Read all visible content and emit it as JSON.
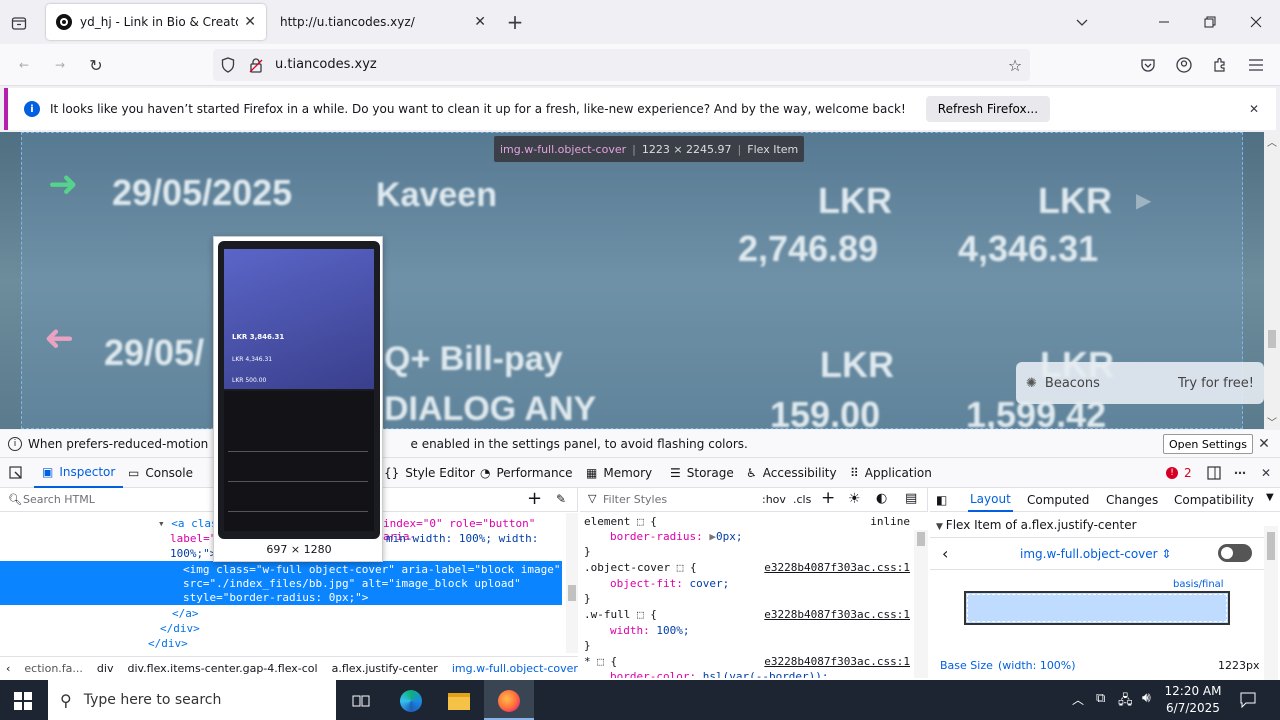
{
  "browser": {
    "tabs": [
      {
        "title": "yd_hj - Link in Bio & Creator To"
      },
      {
        "title": "http://u.tiancodes.xyz/"
      }
    ],
    "url": "u.tiancodes.xyz",
    "notification": {
      "text": "It looks like you haven’t started Firefox in a while. Do you want to clean it up for a fresh, like-new experience? And by the way, welcome back!",
      "button": "Refresh Firefox..."
    }
  },
  "page": {
    "highlighter": {
      "selector": "img.w-full.object-cover",
      "size": "1223 × 2245.97",
      "kind": "Flex Item"
    },
    "row1": {
      "date": "29/05/2025",
      "name": "Kaveen",
      "cur1": "LKR",
      "amt1": "2,746.89",
      "cur2": "LKR",
      "amt2": "4,346.31"
    },
    "row2": {
      "date": "29/05/",
      "name": "Q+ Bill-pay",
      "name2": "DIALOG ANY",
      "cur1": "LKR",
      "amt1": "159.00",
      "cur2": "LKR",
      "amt2": "1,599.42"
    },
    "tooltip_size": "697 × 1280",
    "beacons": {
      "label": "Beacons",
      "cta": "Try for free!"
    }
  },
  "devtools": {
    "warning": {
      "text_a": "When prefers-reduced-motion is en",
      "text_b": "e enabled in the settings panel, to avoid flashing colors.",
      "button": "Open Settings"
    },
    "tabs": [
      "Inspector",
      "Console",
      "Style Editor",
      "Performance",
      "Memory",
      "Storage",
      "Accessibility",
      "Application"
    ],
    "error_count": "2",
    "search_placeholder": "Search HTML",
    "filter_placeholder": "Filter Styles",
    "hov": ":hov",
    "cls": ".cls",
    "html_lines": {
      "l1a": "<a clas",
      "l1b": "index=\"0\" role=\"button\" aria-",
      "l2a": "label=\"",
      "l2b": "min-width: 100%; width:",
      "l3a": "100%;\">",
      "l4": "<img class=\"w-full object-cover\" aria-label=\"block image\"",
      "l5": "src=\"./index_files/bb.jpg\" alt=\"image_block upload\"",
      "l6": "style=\"border-radius: 0px;\">",
      "l7": "</a>",
      "l8": "</div>",
      "l9": "</div>"
    },
    "breadcrumb": [
      "ection.fa...",
      "div",
      "div.flex.items-center.gap-4.flex-col",
      "a.flex.justify-center",
      "img.w-full.object-cover"
    ],
    "rules": [
      {
        "sel": "element",
        "src": "inline",
        "prop": "border-radius:",
        "val": "0px;"
      },
      {
        "sel": ".object-cover",
        "src": "e3228b4087f303ac.css:1",
        "prop": "object-fit:",
        "val": "cover;"
      },
      {
        "sel": ".w-full",
        "src": "e3228b4087f303ac.css:1",
        "prop": "width:",
        "val": "100%;"
      },
      {
        "sel": "*",
        "src": "e3228b4087f303ac.css:1",
        "prop": "border-color:",
        "val": "hsl(var(--border));"
      }
    ],
    "layout_tabs": [
      "Layout",
      "Computed",
      "Changes",
      "Compatibility"
    ],
    "flex_item_header": "Flex Item of a.flex.justify-center",
    "flex_item_name": "img.w-full.object-cover",
    "basis_label": "basis/final",
    "base_size_label": "Base Size",
    "base_size_note": "(width: 100%)",
    "base_size_value": "1223px"
  },
  "taskbar": {
    "search_placeholder": "Type here to search",
    "time": "12:20 AM",
    "date": "6/7/2025"
  }
}
